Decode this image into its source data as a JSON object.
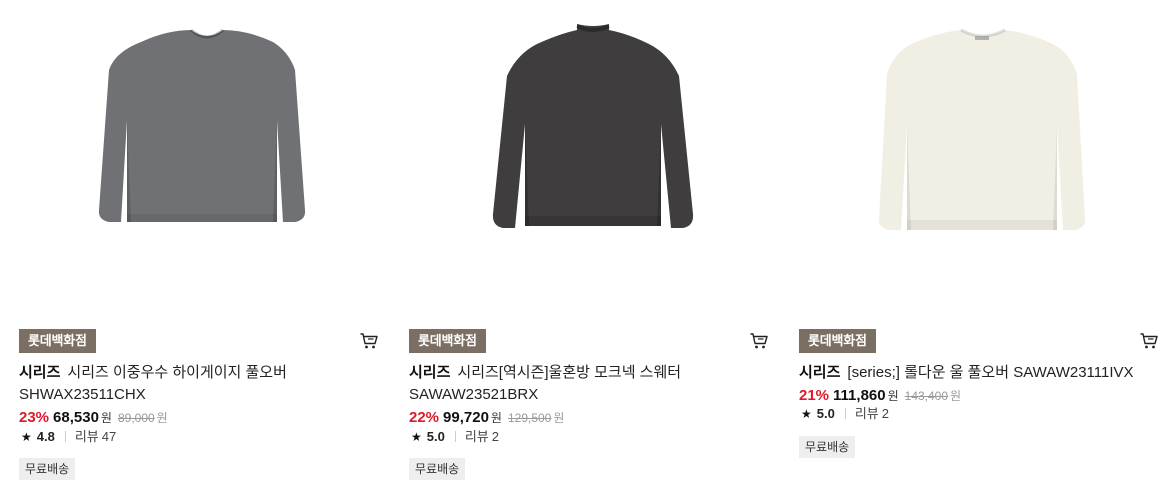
{
  "colors": {
    "discount": "#e0182a",
    "store_badge_bg": "#7b6e62",
    "ship_badge_bg": "#eeeeee"
  },
  "products": [
    {
      "image_color": "#6f7174",
      "store_badge": "롯데백화점",
      "brand": "시리즈",
      "title": "시리즈 이중우수 하이게이지 풀오버 SHWAX23511CHX",
      "discount": "23%",
      "price": "68,530",
      "currency": "원",
      "original_price": "89,000",
      "rating": "4.8",
      "review_label": "리뷰",
      "review_count": "47",
      "shipping": "무료배송",
      "cart_icon": "cart-icon"
    },
    {
      "image_color": "#3f3d3d",
      "store_badge": "롯데백화점",
      "brand": "시리즈",
      "title": "시리즈[역시즌]울혼방 모크넥 스웨터 SAWAW23521BRX",
      "discount": "22%",
      "price": "99,720",
      "currency": "원",
      "original_price": "129,500",
      "rating": "5.0",
      "review_label": "리뷰",
      "review_count": "2",
      "shipping": "무료배송",
      "cart_icon": "cart-icon"
    },
    {
      "image_color": "#f1efe4",
      "store_badge": "롯데백화점",
      "brand": "시리즈",
      "title": "[series;] 롤다운 울 풀오버 SAWAW23111IVX",
      "discount": "21%",
      "price": "111,860",
      "currency": "원",
      "original_price": "143,400",
      "rating": "5.0",
      "review_label": "리뷰",
      "review_count": "2",
      "shipping": "무료배송",
      "cart_icon": "cart-icon"
    }
  ]
}
